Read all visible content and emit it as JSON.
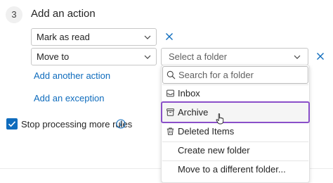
{
  "step": {
    "number": "3",
    "title": "Add an action"
  },
  "actions": {
    "first_select": {
      "value": "Mark as read"
    },
    "second_select": {
      "value": "Move to"
    },
    "folder_select": {
      "placeholder": "Select a folder"
    },
    "add_another_action": "Add another action",
    "add_exception": "Add an exception"
  },
  "stop_processing": {
    "label": "Stop processing more rules",
    "checked": true
  },
  "folder_dropdown": {
    "search_placeholder": "Search for a folder",
    "items": [
      {
        "label": "Inbox",
        "icon": "inbox-icon"
      },
      {
        "label": "Archive",
        "icon": "archive-icon",
        "highlighted": true
      },
      {
        "label": "Deleted Items",
        "icon": "trash-icon"
      },
      {
        "label": "Create new folder",
        "icon": ""
      },
      {
        "label": "Move to a different folder...",
        "icon": ""
      }
    ]
  },
  "colors": {
    "accent": "#0f6cbd",
    "highlight_border": "#8a4fc9",
    "text": "#242424"
  }
}
